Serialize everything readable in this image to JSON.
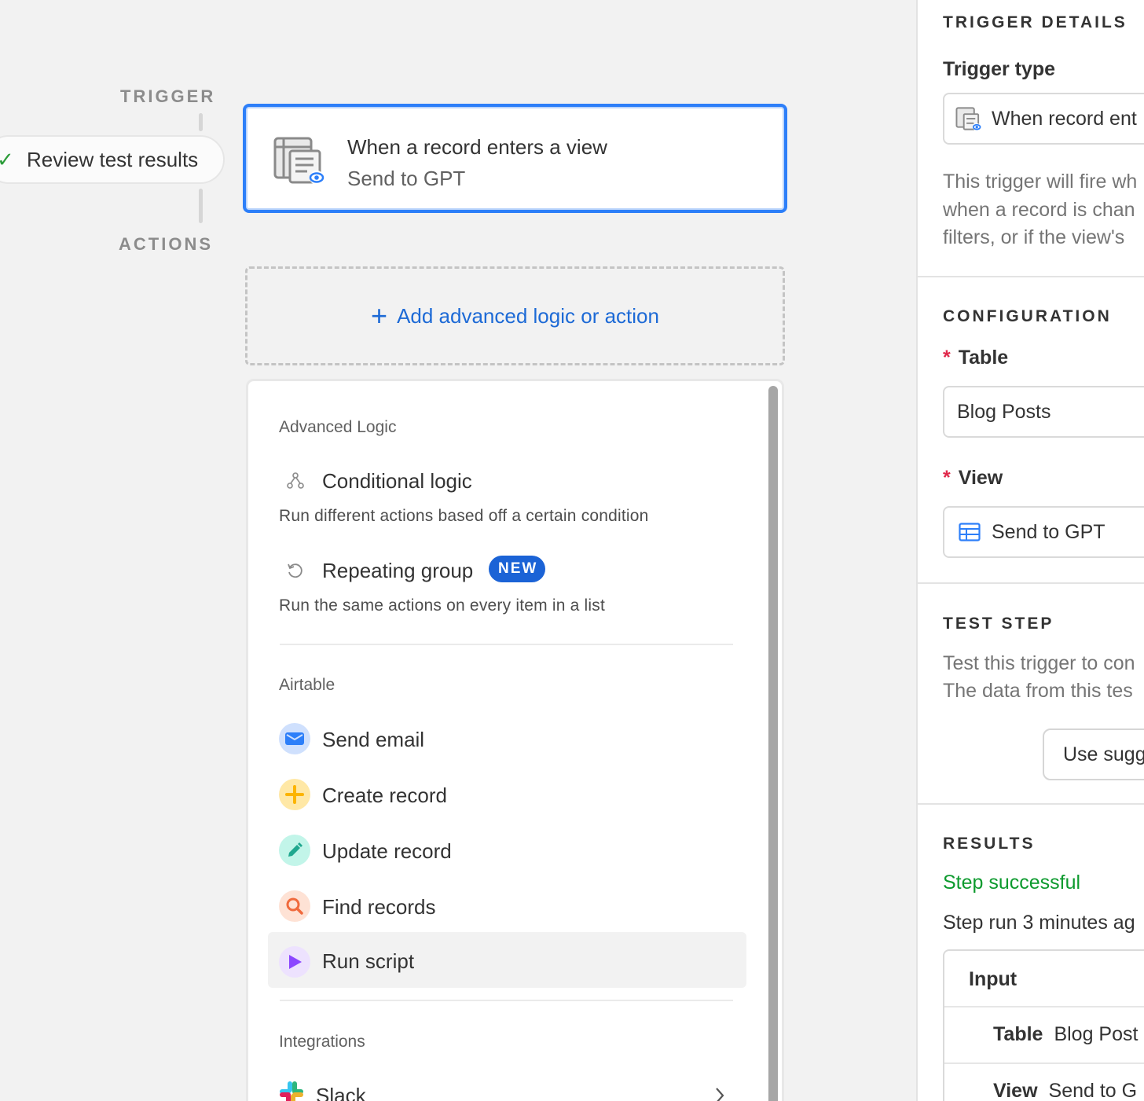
{
  "rail": {
    "trigger_label": "TRIGGER",
    "actions_label": "ACTIONS",
    "review_label": "Review test results"
  },
  "trigger_card": {
    "title": "When a record enters a view",
    "subtitle": "Send to GPT"
  },
  "add_action": {
    "label": "Add advanced logic or action"
  },
  "menu": {
    "sections": {
      "advanced_logic": "Advanced Logic",
      "airtable": "Airtable",
      "integrations": "Integrations"
    },
    "conditional_logic": {
      "title": "Conditional logic",
      "desc": "Run different actions based off a certain condition"
    },
    "repeating_group": {
      "title": "Repeating group",
      "badge": "NEW",
      "desc": "Run the same actions on every item in a list"
    },
    "airtable_items": [
      {
        "label": "Send email",
        "icon": "envelope-icon",
        "color": "#2d7ff9"
      },
      {
        "label": "Create record",
        "icon": "plus-icon",
        "color": "#fcb400"
      },
      {
        "label": "Update record",
        "icon": "pencil-icon",
        "color": "#20c7a8"
      },
      {
        "label": "Find records",
        "icon": "magnifier-icon",
        "color": "#f06a3d"
      },
      {
        "label": "Run script",
        "icon": "play-icon",
        "color": "#8b46ff"
      }
    ],
    "integration_items": [
      {
        "label": "Slack",
        "icon": "slack-icon"
      }
    ]
  },
  "right_panel": {
    "trigger_details_heading": "TRIGGER DETAILS",
    "trigger_type_label": "Trigger type",
    "trigger_type_value": "When record ent",
    "description_lines": [
      "This trigger will fire wh",
      "when a record is chan",
      "filters, or if the view's"
    ],
    "configuration_heading": "CONFIGURATION",
    "table_label": "Table",
    "table_value": "Blog Posts",
    "view_label": "View",
    "view_value": "Send to GPT",
    "test_step_heading": "TEST STEP",
    "test_step_lines": [
      "Test this trigger to con",
      "The data from this tes"
    ],
    "use_suggested_button": "Use sugg",
    "results_heading": "RESULTS",
    "step_status": "Step successful",
    "step_run_time": "Step run 3 minutes ag",
    "input_heading": "Input",
    "input_rows": [
      {
        "key": "Table",
        "value": "Blog Post"
      },
      {
        "key": "View",
        "value": "Send to G"
      }
    ]
  }
}
